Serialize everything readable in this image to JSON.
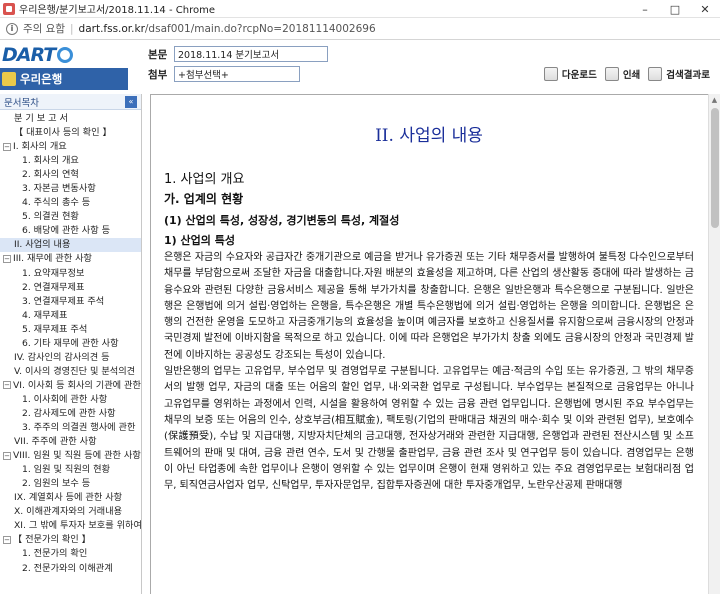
{
  "window": {
    "title": "우리은행/분기보고서/2018.11.14 - Chrome",
    "controls": {
      "minimize": "–",
      "maximize": "□",
      "close": "✕"
    }
  },
  "address_bar": {
    "security": "주의 요함",
    "url_domain": "dart.fss.or.kr",
    "url_path": "/dsaf001/main.do?rcpNo=20181114002696"
  },
  "header": {
    "logo_text": "DART",
    "company": "우리은행",
    "doc_label": "본문",
    "doc_value": "2018.11.14  분기보고서",
    "attach_label": "첨부",
    "attach_value": "+첨부선택+",
    "tools": [
      {
        "label": "다운로드",
        "icon": "download-icon"
      },
      {
        "label": "인쇄",
        "icon": "print-icon"
      },
      {
        "label": "검색결과로",
        "icon": "search-result-icon"
      }
    ]
  },
  "sidebar": {
    "title": "문서목차",
    "collapse": "«",
    "items": [
      {
        "label": "분 기 보 고 서",
        "level": 1
      },
      {
        "label": "【 대표이사 등의 확인 】",
        "level": 1
      },
      {
        "label": "I. 회사의 개요",
        "level": 0,
        "toggle": "−"
      },
      {
        "label": "1. 회사의 개요",
        "level": 2
      },
      {
        "label": "2. 회사의 연혁",
        "level": 2
      },
      {
        "label": "3. 자본금 변동사항",
        "level": 2
      },
      {
        "label": "4. 주식의 총수 등",
        "level": 2
      },
      {
        "label": "5. 의결권 현황",
        "level": 2
      },
      {
        "label": "6. 배당에 관한 사항 등",
        "level": 2
      },
      {
        "label": "II. 사업의 내용",
        "level": 1,
        "selected": true
      },
      {
        "label": "III. 재무에 관한 사항",
        "level": 0,
        "toggle": "−"
      },
      {
        "label": "1. 요약재무정보",
        "level": 2
      },
      {
        "label": "2. 연결재무제표",
        "level": 2
      },
      {
        "label": "3. 연결재무제표 주석",
        "level": 2
      },
      {
        "label": "4. 재무제표",
        "level": 2
      },
      {
        "label": "5. 재무제표 주석",
        "level": 2
      },
      {
        "label": "6. 기타 재무에 관한 사항",
        "level": 2
      },
      {
        "label": "IV. 감사인의 감사의견 등",
        "level": 1
      },
      {
        "label": "V. 이사의 경영진단 및 분석의견",
        "level": 1
      },
      {
        "label": "VI. 이사회 등 회사의 기관에 관한",
        "level": 0,
        "toggle": "−"
      },
      {
        "label": "1. 이사회에 관한 사항",
        "level": 2
      },
      {
        "label": "2. 감사제도에 관한 사항",
        "level": 2
      },
      {
        "label": "3. 주주의 의결권 행사에 관한",
        "level": 2
      },
      {
        "label": "VII. 주주에 관한 사항",
        "level": 1
      },
      {
        "label": "VIII. 임원 및 직원 등에 관한 사항",
        "level": 0,
        "toggle": "−"
      },
      {
        "label": "1. 임원 및 직원의 현황",
        "level": 2
      },
      {
        "label": "2. 임원의 보수 등",
        "level": 2
      },
      {
        "label": "IX. 계열회사 등에 관한 사항",
        "level": 1
      },
      {
        "label": "X. 이해관계자와의 거래내용",
        "level": 1
      },
      {
        "label": "XI. 그 밖에 투자자 보호를 위하여",
        "level": 1
      },
      {
        "label": "【 전문가의 확인 】",
        "level": 0,
        "toggle": "−"
      },
      {
        "label": "1. 전문가의 확인",
        "level": 2
      },
      {
        "label": "2. 전문가와의 이해관계",
        "level": 2
      }
    ]
  },
  "document": {
    "section_title": "II. 사업의 내용",
    "h1": "1. 사업의 개요",
    "h2": "가. 업계의 현황",
    "h3": "(1) 산업의 특성, 성장성, 경기변동의 특성, 계절성",
    "h4": "1) 산업의 특성",
    "para1": "은행은 자금의 수요자와 공급자간 중개기관으로 예금을 받거나 유가증권 또는 기타 채무증서를 발행하여 불특정 다수인으로부터 채무를 부담함으로써 조달한 자금을 대출합니다.자원 배분의 효율성을 제고하며, 다른 산업의 생산활동 증대에 따라 발생하는 금융수요와 관련된 다양한 금융서비스 제공을 통해 부가가치를 창출합니다. 은행은 일반은행과 특수은행으로 구분됩니다. 일반은행은 은행법에 의거 설립·영업하는 은행을, 특수은행은 개별 특수은행법에 의거 설립·영업하는 은행을 의미합니다. 은행법은 은행의 건전한 운영을 도모하고 자금중개기능의 효율성을 높이며 예금자를 보호하고 신용질서를 유지함으로써 금융시장의 안정과 국민경제 발전에 이바지함을 목적으로 하고 있습니다. 이에 따라 은행업은 부가가치 창출 외에도 금융시장의 안정과 국민경제 발전에 이바지하는 공공성도  강조되는 특성이 있습니다.",
    "para2": "일반은행의 업무는 고유업무, 부수업무 및 겸영업무로 구분됩니다. 고유업무는 예금·적금의 수입 또는 유가증권, 그 밖의 채무증서의 발행 업무, 자금의 대출 또는 어음의 할인 업무, 내·외국환 업무로 구성됩니다. 부수업무는 본질적으로 금융업무는 아니나 고유업무를 영위하는 과정에서 인력, 시설을 활용하여 영위할 수 있는 금융 관련 업무입니다. 은행법에 명시된 주요 부수업무는 채무의 보증 또는 어음의 인수, 상호부금(相互賦金), 팩토링(기업의 판매대금 채권의 매수·회수 및 이와 관련된 업무), 보호예수(保護預受), 수납 및 지급대행, 지방자치단체의 금고대행, 전자상거래와 관련한 지급대행, 은행업과 관련된 전산시스템 및 소프트웨어의 판매 및 대여, 금융 관련 연수, 도서 및 간행물 출판업무, 금융 관련 조사 및 연구업무 등이 있습니다. 겸영업무는 은행이 아닌 타업종에 속한 업무이나 은행이 영위할 수 있는 업무이며 은행이 현재 영위하고 있는 주요 겸영업무로는 보험대리점 업무, 퇴직연금사업자 업무, 신탁업무, 투자자문업무, 집합투자증권에 대한 투자중개업무, 노란우산공제 판매대행"
  }
}
